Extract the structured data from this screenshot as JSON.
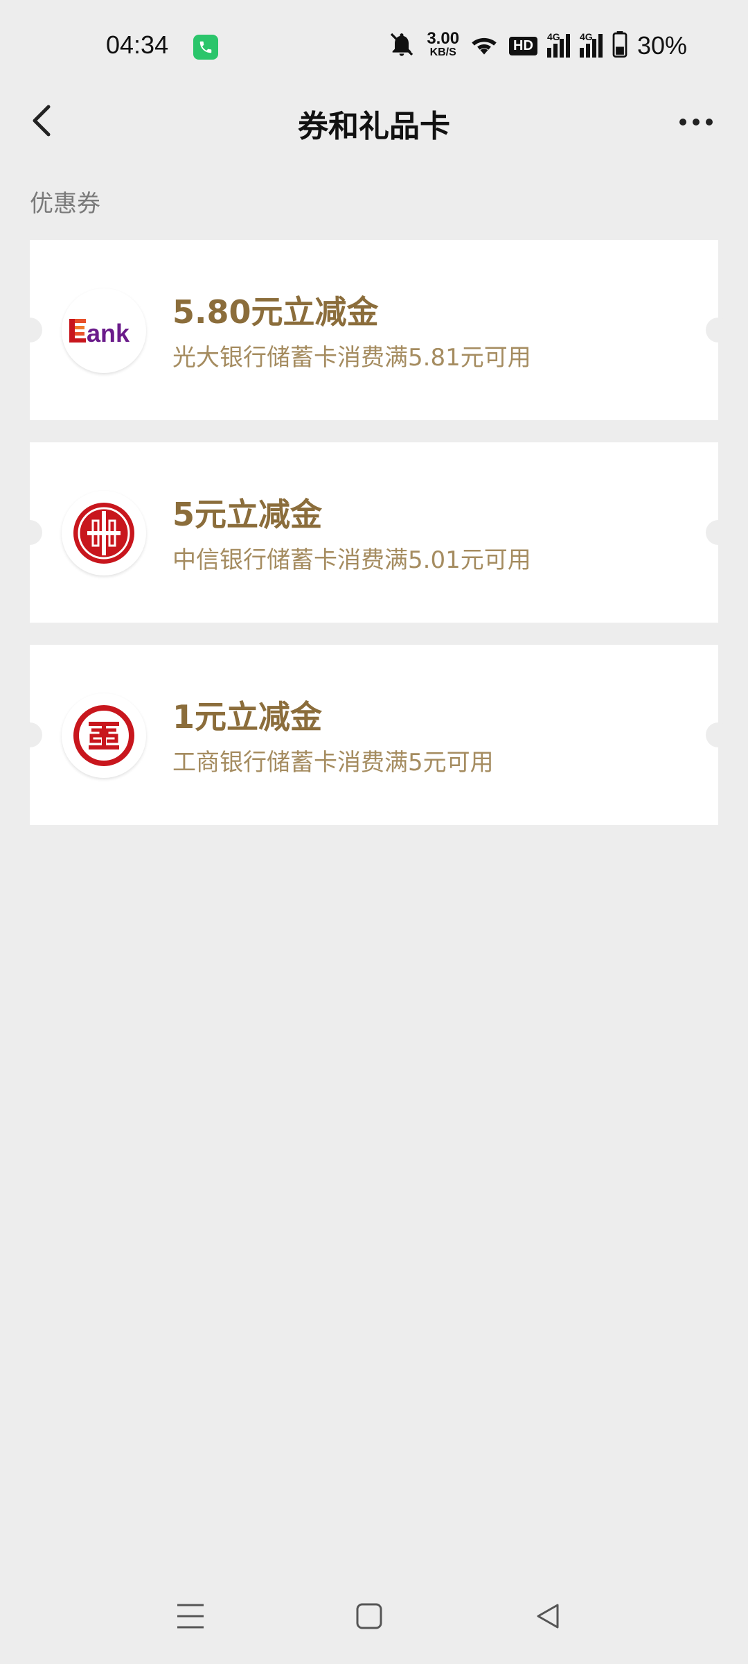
{
  "status_bar": {
    "time": "04:34",
    "net_speed_value": "3.00",
    "net_speed_unit": "KB/S",
    "hd_label": "HD",
    "sim1_label": "4G",
    "sim2_label": "4G",
    "battery": "30%"
  },
  "header": {
    "title": "券和礼品卡"
  },
  "section": {
    "label": "优惠券"
  },
  "coupons": [
    {
      "title": "5.80元立减金",
      "desc": "光大银行储蓄卡消费满5.81元可用",
      "logo_text": "ank"
    },
    {
      "title": "5元立减金",
      "desc": "中信银行储蓄卡消费满5.01元可用"
    },
    {
      "title": "1元立减金",
      "desc": "工商银行储蓄卡消费满5元可用"
    }
  ],
  "colors": {
    "background": "#ededed",
    "card": "#ffffff",
    "coupon_title": "#8b6d3b",
    "coupon_desc": "#a58c60",
    "bank_red": "#c8161d",
    "bank_purple": "#6a1b8a",
    "call_green": "#2bc56b"
  }
}
